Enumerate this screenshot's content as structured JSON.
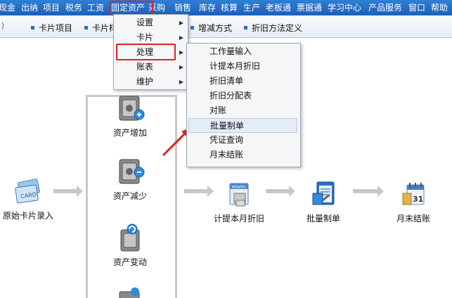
{
  "menubar": {
    "items": [
      "现金",
      "出纳",
      "项目",
      "税务",
      "工资",
      "固定资产",
      "采购",
      "销售",
      "库存",
      "核算",
      "生产",
      "老板通",
      "票据通",
      "学习中心",
      "产品服务",
      "窗口",
      "帮助"
    ]
  },
  "toolbar": {
    "items": [
      "卡片项目",
      "卡片样",
      "增减方式",
      "折旧方法定义"
    ]
  },
  "menu_level1": {
    "items": [
      "设置",
      "卡片",
      "处理",
      "账表",
      "维护"
    ]
  },
  "menu_level2": {
    "items": [
      "工作量输入",
      "计提本月折旧",
      "折旧清单",
      "折旧分配表",
      "对账",
      "批量制单",
      "凭证查询",
      "月末结账"
    ]
  },
  "flow": {
    "nodes": [
      "原始卡片录入",
      "资产增加",
      "资产减少",
      "资产变动",
      "计提本月折旧",
      "批量制单",
      "月末结账"
    ]
  },
  "colors": {
    "menubar": "#1c5fb8",
    "highlight": "#e02020",
    "arrow_red": "#e02020"
  }
}
